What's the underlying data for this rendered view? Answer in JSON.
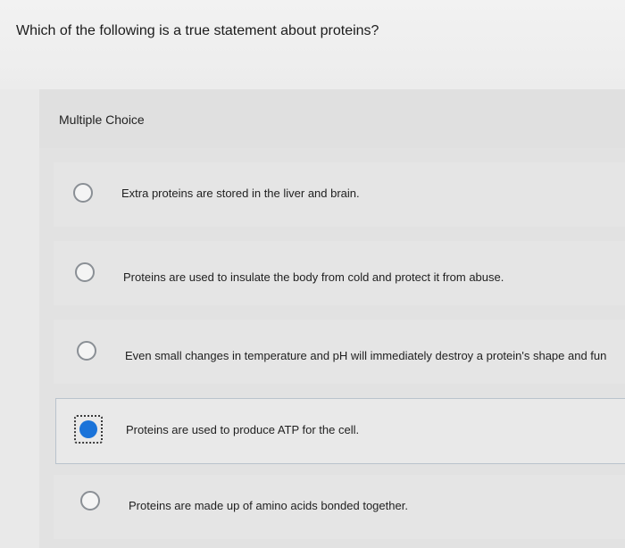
{
  "question": {
    "text": "Which of the following is a true statement about proteins?"
  },
  "section": {
    "label": "Multiple Choice"
  },
  "options": [
    {
      "label": "Extra proteins are stored in the liver and brain.",
      "selected": false
    },
    {
      "label": "Proteins are used to insulate the body from cold and protect it from abuse.",
      "selected": false
    },
    {
      "label": "Even small changes in temperature and pH will immediately destroy a protein's shape and fun",
      "selected": false
    },
    {
      "label": "Proteins are used to produce ATP for the cell.",
      "selected": true
    },
    {
      "label": "Proteins are made up of amino acids bonded together.",
      "selected": false
    }
  ],
  "colors": {
    "selected_radio": "#1a73d9",
    "radio_border": "#8a8f95"
  }
}
